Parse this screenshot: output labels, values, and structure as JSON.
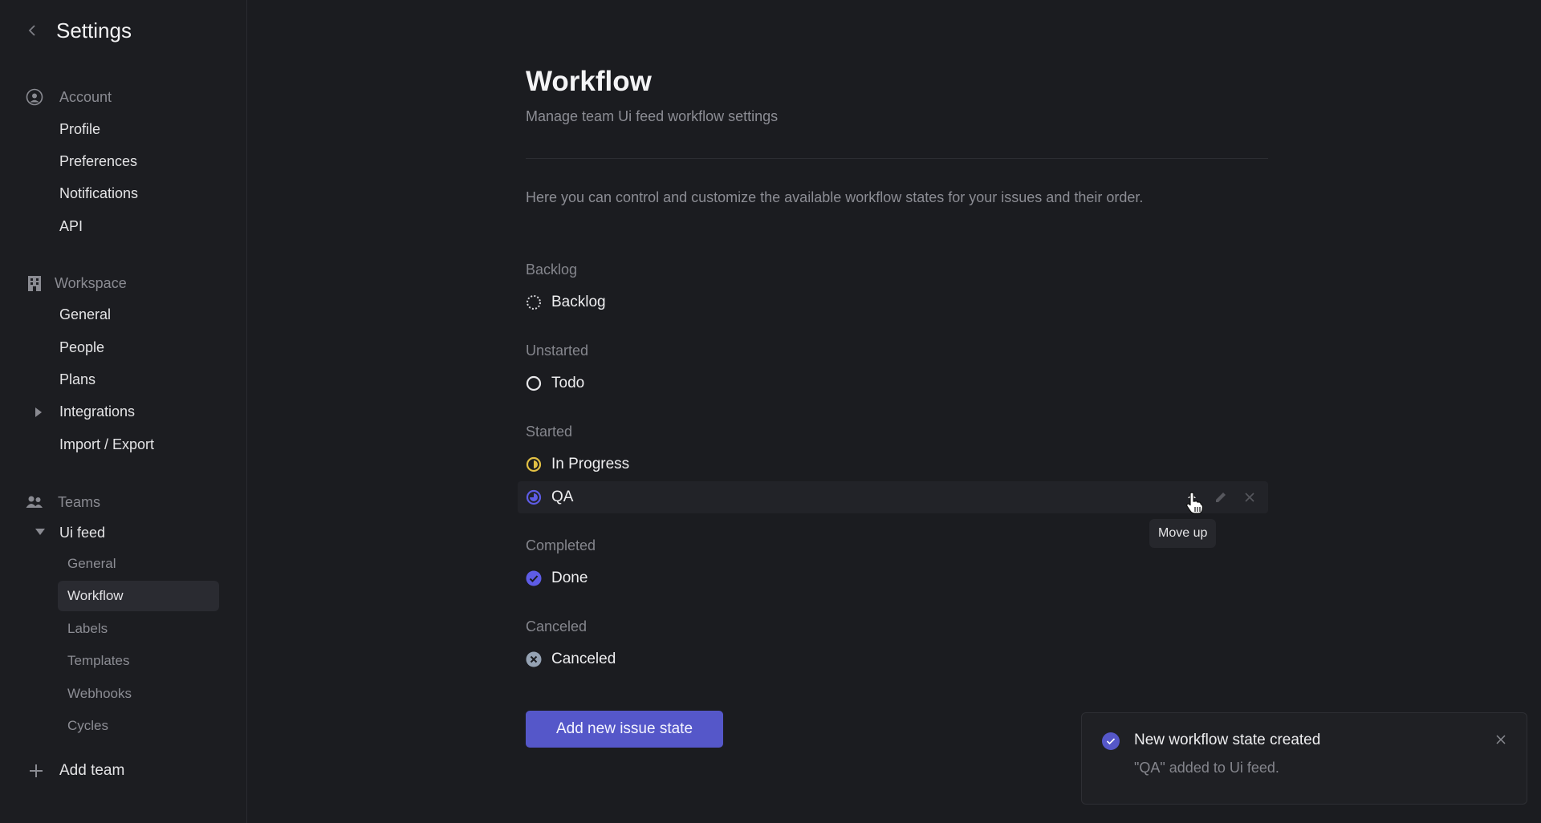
{
  "sidebar": {
    "title": "Settings",
    "account": {
      "label": "Account",
      "items": [
        {
          "label": "Profile"
        },
        {
          "label": "Preferences"
        },
        {
          "label": "Notifications"
        },
        {
          "label": "API"
        }
      ]
    },
    "workspace": {
      "label": "Workspace",
      "items": [
        {
          "label": "General"
        },
        {
          "label": "People"
        },
        {
          "label": "Plans"
        },
        {
          "label": "Integrations"
        },
        {
          "label": "Import / Export"
        }
      ]
    },
    "teams": {
      "label": "Teams",
      "team_name": "Ui feed",
      "items": [
        {
          "label": "General"
        },
        {
          "label": "Workflow",
          "active": true
        },
        {
          "label": "Labels"
        },
        {
          "label": "Templates"
        },
        {
          "label": "Webhooks"
        },
        {
          "label": "Cycles"
        }
      ],
      "add_label": "Add team"
    }
  },
  "main": {
    "title": "Workflow",
    "subtitle": "Manage team Ui feed workflow settings",
    "description": "Here you can control and customize the available workflow states for your issues and their order.",
    "groups": [
      {
        "label": "Backlog",
        "states": [
          {
            "name": "Backlog",
            "icon": "backlog-dashed-circle-icon"
          }
        ]
      },
      {
        "label": "Unstarted",
        "states": [
          {
            "name": "Todo",
            "icon": "todo-circle-icon"
          }
        ]
      },
      {
        "label": "Started",
        "states": [
          {
            "name": "In Progress",
            "icon": "in-progress-icon",
            "color": "#e2c044"
          },
          {
            "name": "QA",
            "icon": "qa-icon",
            "color": "#5e5ce6"
          }
        ]
      },
      {
        "label": "Completed",
        "states": [
          {
            "name": "Done",
            "icon": "done-check-icon",
            "color": "#5e5ce6"
          }
        ]
      },
      {
        "label": "Canceled",
        "states": [
          {
            "name": "Canceled",
            "icon": "canceled-x-icon",
            "color": "#95a2b3"
          }
        ]
      }
    ],
    "tooltip": "Move up",
    "add_button": "Add new issue state"
  },
  "toast": {
    "title": "New workflow state created",
    "message": "\"QA\" added to Ui feed."
  },
  "colors": {
    "accent": "#5557c9",
    "in_progress": "#e2c044",
    "canceled": "#95a2b3"
  }
}
